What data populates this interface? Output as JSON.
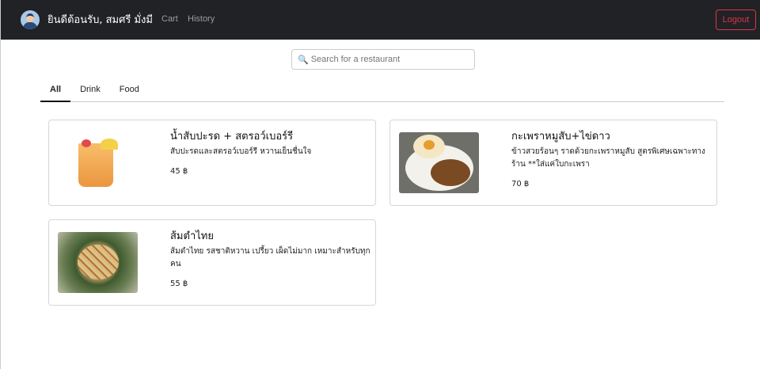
{
  "navbar": {
    "welcome": "ยินดีต้อนรับ, สมศรี มั่งมี",
    "links": [
      "Cart",
      "History"
    ],
    "logout": "Logout"
  },
  "search": {
    "placeholder": "Search for a restaurant",
    "value": ""
  },
  "tabs": [
    {
      "label": "All",
      "active": true
    },
    {
      "label": "Drink"
    },
    {
      "label": "Food"
    }
  ],
  "items": [
    {
      "name": "น้ำสับปะรด + สตรอว์เบอร์รี",
      "description": "สับปะรดและสตรอว์เบอร์รี หวานเย็นชื่นใจ",
      "price": "45 ฿"
    },
    {
      "name": "กะเพราหมูสับ+ไข่ดาว",
      "description": "ข้าวสวยร้อนๆ ราดด้วยกะเพราหมูสับ สูตรพิเศษเฉพาะทางร้าน **ใส่แค่ใบกะเพรา",
      "price": "70 ฿"
    },
    {
      "name": "ส้มตำไทย",
      "description": "ส้มตำไทย รสชาติหวาน เปรี้ยว เผ็ดไม่มาก เหมาะสำหรับทุกคน",
      "price": "55 ฿"
    }
  ],
  "colors": {
    "navbar": "#212226",
    "logout": "#dc3545"
  }
}
